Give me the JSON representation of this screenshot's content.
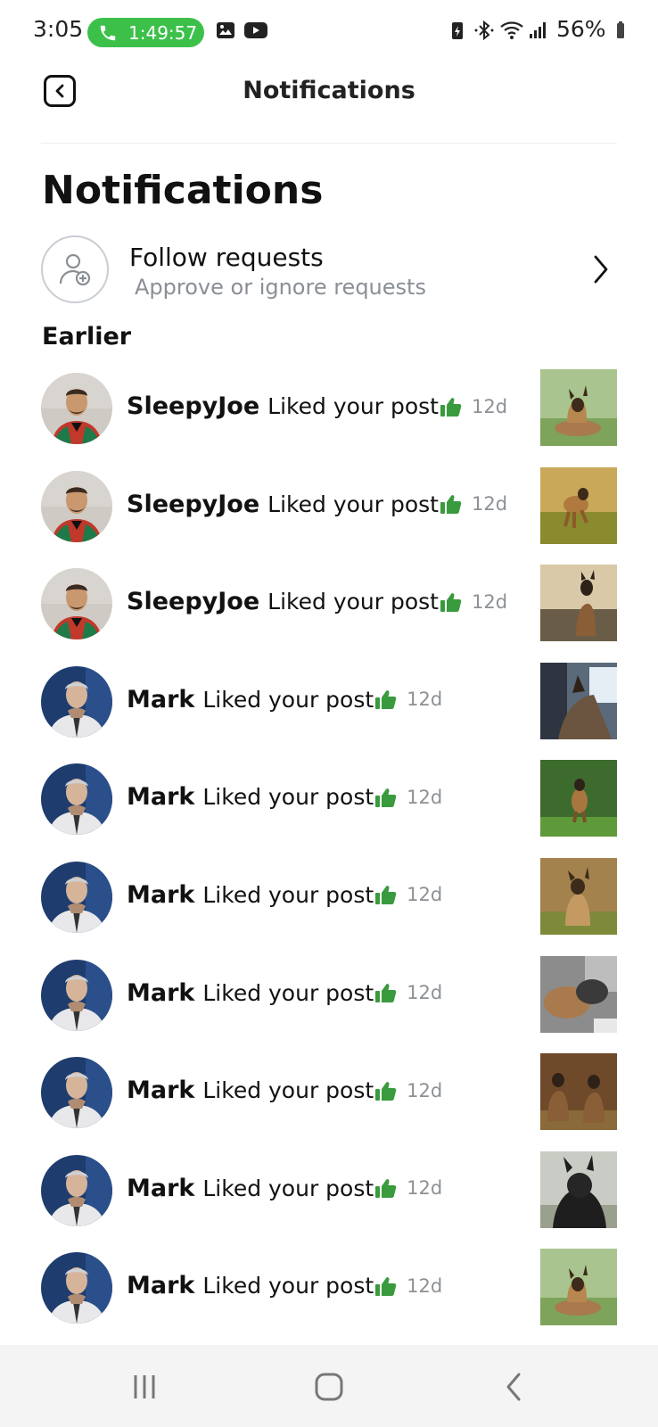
{
  "status_bar": {
    "time": "3:05",
    "call_timer": "1:49:57",
    "battery": "56%",
    "call_color": "#3cc04a"
  },
  "header": {
    "title": "Notifications",
    "back_icon": "chevron-left-icon"
  },
  "page_title": "Notifications",
  "follow_requests": {
    "title": "Follow requests",
    "subtitle": "Approve or ignore requests",
    "icon": "add-user-icon"
  },
  "section_label": "Earlier",
  "accent_color": "#3a9a3e",
  "notifications": [
    {
      "name": "SleepyJoe",
      "message": "Liked your post",
      "time": "12d",
      "user": "sleepyjoe",
      "thumb": "dog-lying-grass"
    },
    {
      "name": "SleepyJoe",
      "message": "Liked your post",
      "time": "12d",
      "user": "sleepyjoe",
      "thumb": "dog-running-field"
    },
    {
      "name": "SleepyJoe",
      "message": "Liked your post",
      "time": "12d",
      "user": "sleepyjoe",
      "thumb": "dog-sitting-shore"
    },
    {
      "name": "Mark",
      "message": "Liked your post",
      "time": "12d",
      "user": "mark",
      "thumb": "dog-in-car"
    },
    {
      "name": "Mark",
      "message": "Liked your post",
      "time": "12d",
      "user": "mark",
      "thumb": "dog-running-lawn"
    },
    {
      "name": "Mark",
      "message": "Liked your post",
      "time": "12d",
      "user": "mark",
      "thumb": "puppy-sitting"
    },
    {
      "name": "Mark",
      "message": "Liked your post",
      "time": "12d",
      "user": "mark",
      "thumb": "dogs-cuddling"
    },
    {
      "name": "Mark",
      "message": "Liked your post",
      "time": "12d",
      "user": "mark",
      "thumb": "two-dogs-sitting"
    },
    {
      "name": "Mark",
      "message": "Liked your post",
      "time": "12d",
      "user": "mark",
      "thumb": "black-dog-lying"
    },
    {
      "name": "Mark",
      "message": "Liked your post",
      "time": "12d",
      "user": "mark",
      "thumb": "dog-lying-grass"
    }
  ],
  "nav_bar": {
    "recents_icon": "recents-icon",
    "home_icon": "home-icon",
    "back_icon": "back-icon"
  }
}
